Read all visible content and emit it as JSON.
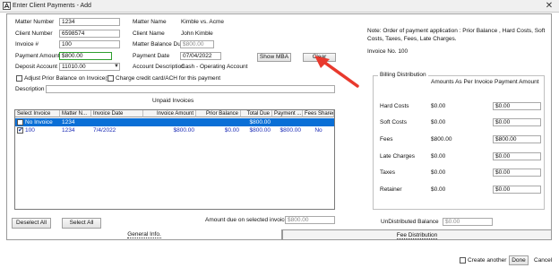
{
  "window": {
    "title": "Enter Client Payments - Add",
    "close": "✕"
  },
  "form": {
    "matter_number": {
      "label": "Matter Number",
      "value": "1234"
    },
    "client_number": {
      "label": "Client Number",
      "value": "6598574"
    },
    "invoice_no": {
      "label": "Invoice #",
      "value": "100"
    },
    "payment_amount": {
      "label": "Payment Amount",
      "value": "$800.00"
    },
    "deposit_account": {
      "label": "Deposit Account",
      "value": "11010.00"
    },
    "matter_name": {
      "label": "Matter Name",
      "value": "Kimble vs. Acme"
    },
    "client_name": {
      "label": "Client Name",
      "value": "John Kimble"
    },
    "matter_balance_due": {
      "label": "Matter Balance Due",
      "value": "$800.00"
    },
    "payment_date": {
      "label": "Payment Date",
      "value": "07/04/2022"
    },
    "account_description": {
      "label": "Account Description",
      "value": "Cash - Operating Account"
    },
    "show_mba": "Show MBA",
    "clear": "Clear",
    "adjust_prior": "Adjust Prior Balance on Invoice(s)",
    "charge_credit": "Charge credit card/ACH for this payment",
    "description_label": "Description",
    "description_value": ""
  },
  "note": {
    "text": "Note: Order of payment application : Prior Balance , Hard Costs, Soft Costs, Taxes, Fees, Late Charges.",
    "invoice_line": "Invoice No. 100"
  },
  "unpaid": {
    "title": "Unpaid Invoices",
    "columns": [
      "Select Invoice",
      "Matter N...",
      "Invoice Date",
      "Invoice Amount",
      "Prior Balance",
      "Total Due",
      "Payment ...",
      "Fees Shared"
    ],
    "rows": [
      {
        "checked": false,
        "select": "No Invoice",
        "matter": "1234",
        "date": "",
        "amount": "",
        "prior": "",
        "total": "$800.00",
        "payment": "",
        "fees": ""
      },
      {
        "checked": true,
        "select": "100",
        "matter": "1234",
        "date": "7/4/2022",
        "amount": "$800.00",
        "prior": "$0.00",
        "total": "$800.00",
        "payment": "$800.00",
        "fees": "No"
      }
    ]
  },
  "actions": {
    "deselect_all": "Deselect All",
    "select_all": "Select All",
    "amount_due_label": "Amount due on selected invoice(s)",
    "amount_due_value": "$800.00"
  },
  "billing": {
    "title": "Billing Distribution",
    "col_amounts": "Amounts As Per Invoice",
    "col_payment": "Payment  Amount",
    "rows": [
      {
        "label": "Hard Costs",
        "invoice": "$0.00",
        "payment": "$0.00"
      },
      {
        "label": "Soft Costs",
        "invoice": "$0.00",
        "payment": "$0.00"
      },
      {
        "label": "Fees",
        "invoice": "$800.00",
        "payment": "$800.00"
      },
      {
        "label": "Late Charges",
        "invoice": "$0.00",
        "payment": "$0.00"
      },
      {
        "label": "Taxes",
        "invoice": "$0.00",
        "payment": "$0.00"
      },
      {
        "label": "Retainer",
        "invoice": "$0.00",
        "payment": "$0.00"
      }
    ],
    "undistributed_label": "UnDistributed Balance",
    "undistributed_value": "$0.00"
  },
  "tabs": {
    "general": "General Info.",
    "fee": "Fee Distribution"
  },
  "footer": {
    "create_another": "Create another",
    "done": "Done",
    "cancel": "Cancel"
  }
}
